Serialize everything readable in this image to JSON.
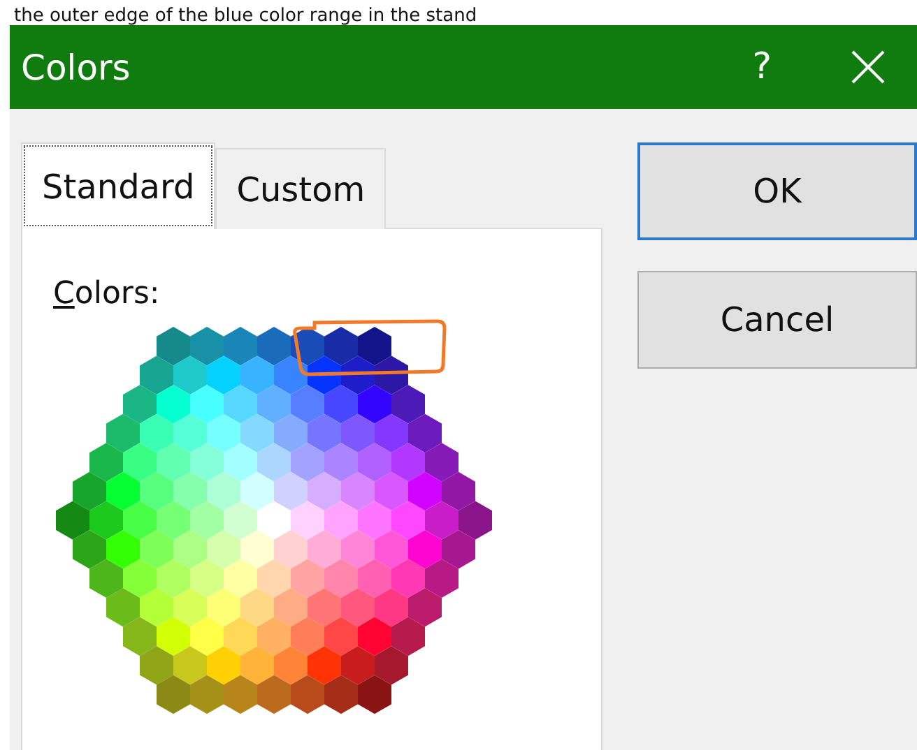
{
  "caption": "the outer edge of the blue color range in the stand",
  "window": {
    "title": "Colors",
    "help": "?"
  },
  "tabs": [
    {
      "label": "Standard",
      "selected": true
    },
    {
      "label": "Custom",
      "selected": false
    }
  ],
  "palette_label": "Colors:",
  "buttons": [
    {
      "label": "OK",
      "default": true
    },
    {
      "label": "Cancel",
      "default": false
    }
  ]
}
